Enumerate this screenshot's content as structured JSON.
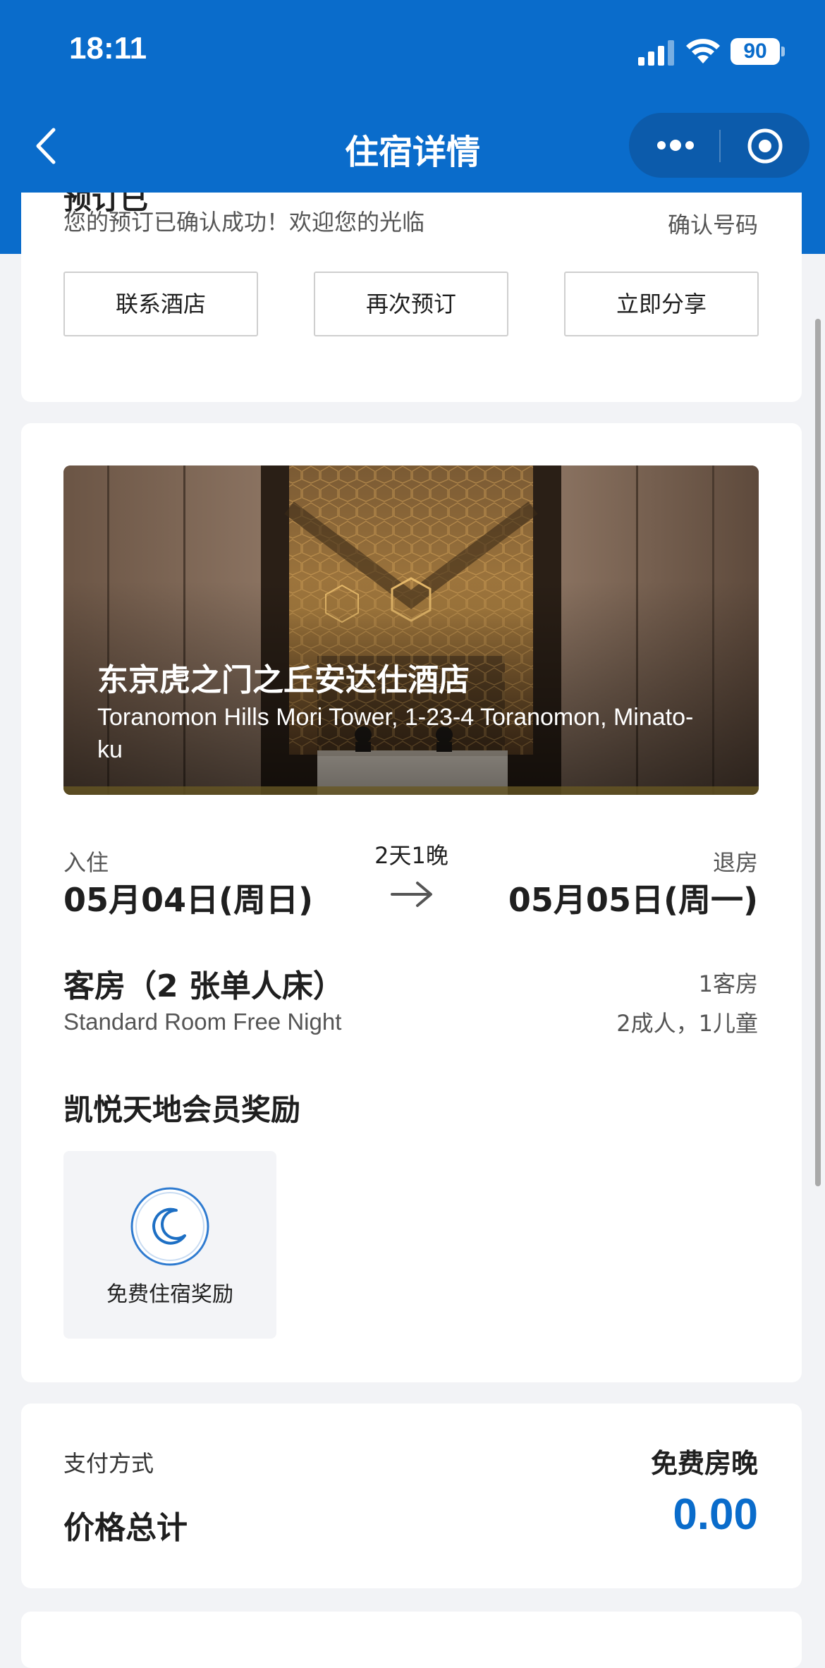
{
  "status_bar": {
    "time": "18:11",
    "battery": "90"
  },
  "nav": {
    "title": "住宿详情"
  },
  "confirmation": {
    "partial_heading": "预订已",
    "message": "您的预订已确认成功！欢迎您的光临",
    "number_label": "确认号码",
    "buttons": [
      "联系酒店",
      "再次预订",
      "立即分享"
    ]
  },
  "hotel": {
    "name": "东京虎之门之丘安达仕酒店",
    "address": "Toranomon Hills Mori Tower, 1-23-4 Toranomon, Minato-ku"
  },
  "stay": {
    "checkin_label": "入住",
    "checkin_date": "05月04日(周日)",
    "nights": "2天1晚",
    "checkout_label": "退房",
    "checkout_date": "05月05日(周一)"
  },
  "room": {
    "title": "客房（2 张单人床）",
    "name_en": "Standard Room Free Night",
    "count": "1客房",
    "guests": "2成人，1儿童"
  },
  "rewards": {
    "title": "凯悦天地会员奖励",
    "items": [
      {
        "label": "免费住宿奖励",
        "icon": "moon-icon"
      }
    ]
  },
  "payment": {
    "method_label": "支付方式",
    "method_value": "免费房晚",
    "total_label": "价格总计",
    "total_value": "0.00"
  },
  "colors": {
    "brand_blue": "#0a6ccb",
    "capsule": "#0c5bab",
    "background": "#f2f3f6"
  }
}
